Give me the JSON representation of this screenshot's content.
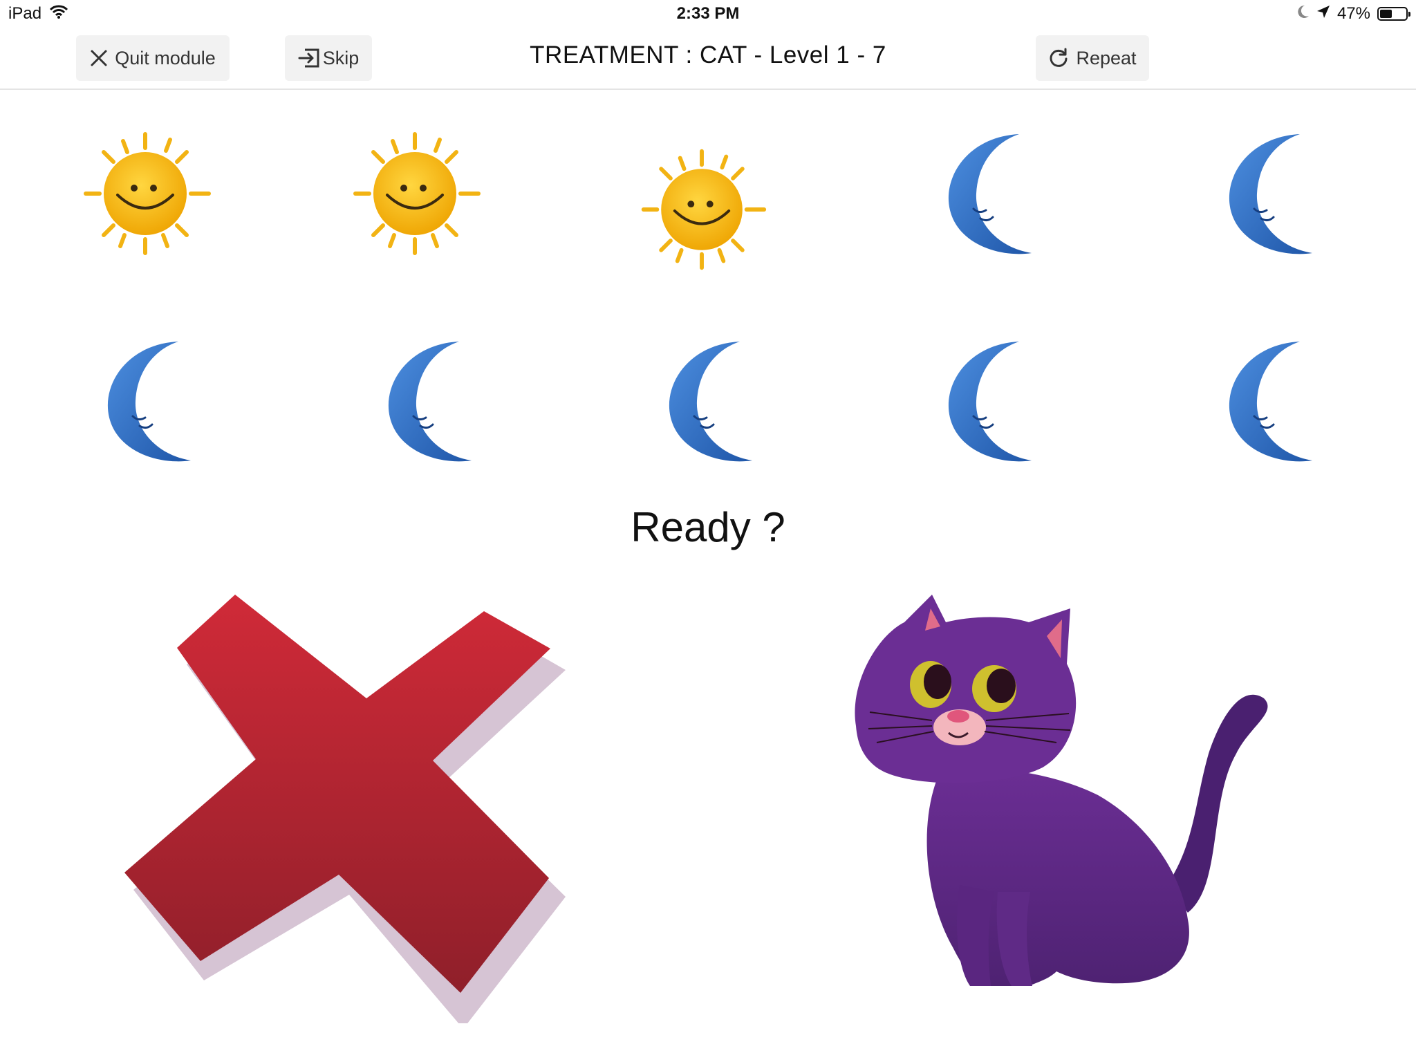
{
  "status_bar": {
    "device": "iPad",
    "time": "2:33 PM",
    "battery_percent": "47%",
    "battery_level": 0.47
  },
  "toolbar": {
    "quit_label": "Quit module",
    "skip_label": "Skip",
    "title": "TREATMENT : CAT - Level 1 - 7",
    "repeat_label": "Repeat"
  },
  "grid": {
    "row1": [
      "sun-icon",
      "sun-icon",
      "sun-icon",
      "moon-icon",
      "moon-icon"
    ],
    "row2": [
      "moon-icon",
      "moon-icon",
      "moon-icon",
      "moon-icon",
      "moon-icon"
    ]
  },
  "prompt": "Ready ?",
  "choices": [
    "cross-icon",
    "cat-icon"
  ],
  "colors": {
    "sun": "#f2b313",
    "moon": "#2f6fc4",
    "cross": "#c42836",
    "cat": "#6a2e8e"
  }
}
